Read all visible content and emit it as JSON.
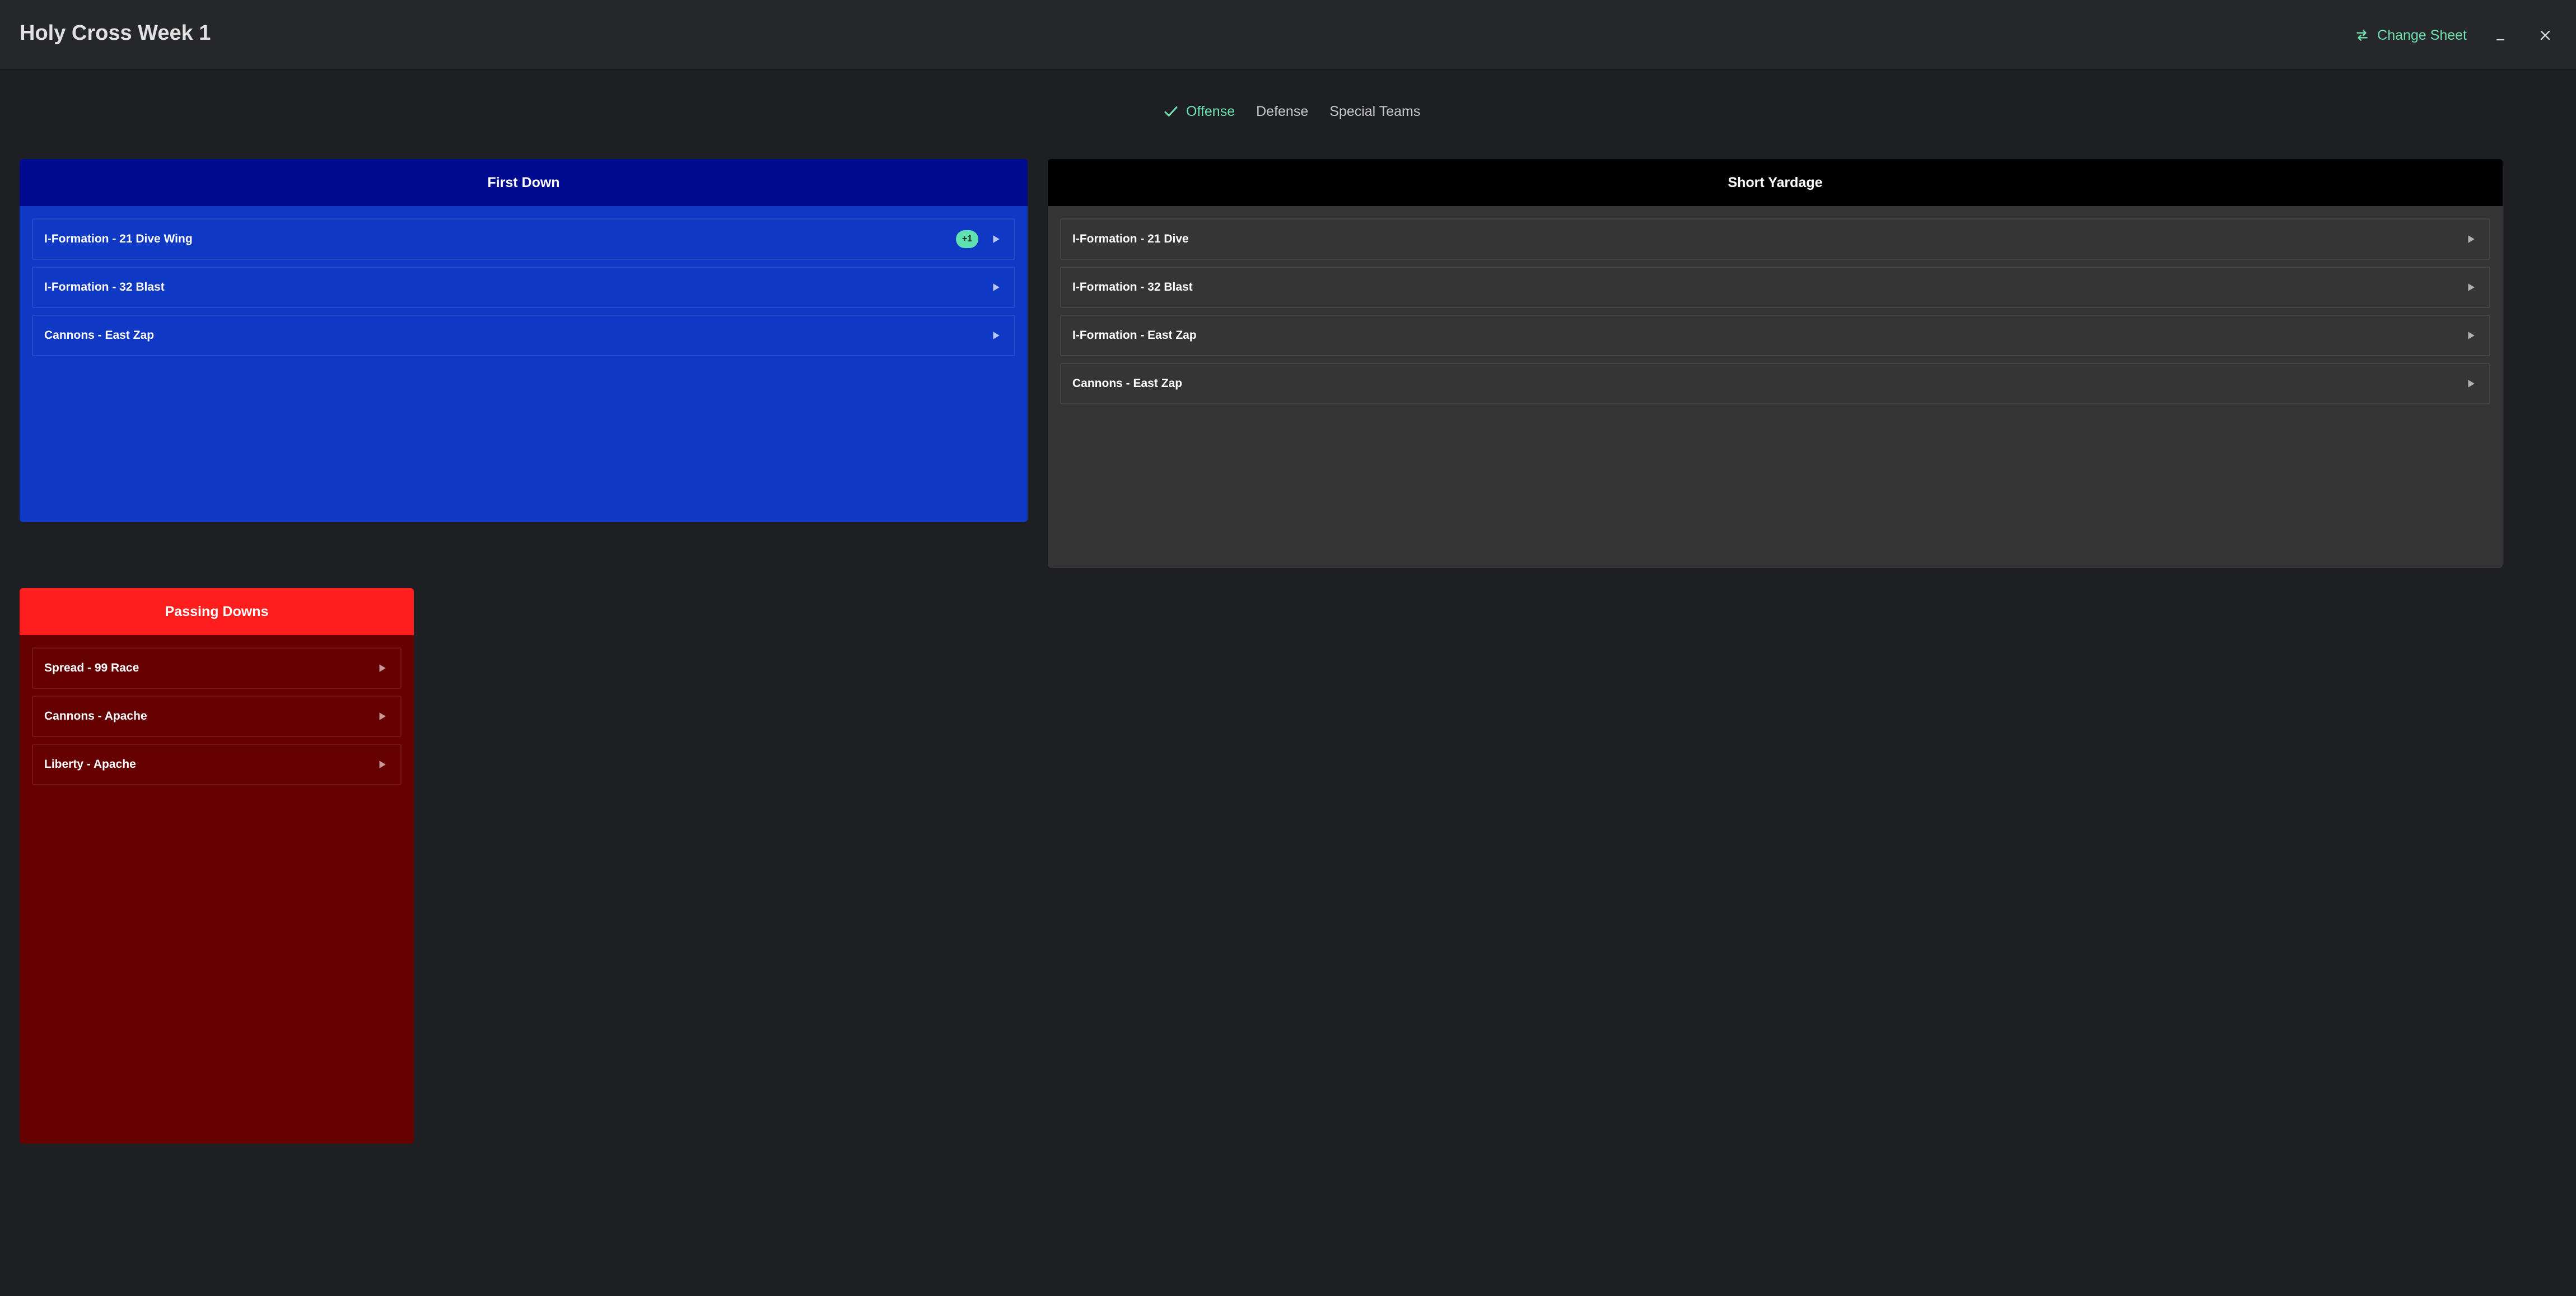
{
  "header": {
    "title": "Holy Cross Week 1",
    "change_sheet_label": "Change Sheet",
    "change_sheet_icon": "swap-arrows-icon",
    "accent_color": "#6fe3b1"
  },
  "tabs": [
    {
      "label": "Offense",
      "active": true,
      "icon": "check-icon"
    },
    {
      "label": "Defense",
      "active": false
    },
    {
      "label": "Special Teams",
      "active": false
    }
  ],
  "cards": {
    "first_down": {
      "title": "First Down",
      "header_color": "#000b8f",
      "body_color": "#0f39c4",
      "plays": [
        {
          "label": "I-Formation - 21 Dive Wing",
          "badge": "+1"
        },
        {
          "label": "I-Formation - 32 Blast"
        },
        {
          "label": "Cannons - East Zap"
        }
      ]
    },
    "short_yardage": {
      "title": "Short Yardage",
      "header_color": "#000000",
      "body_color": "#353535",
      "plays": [
        {
          "label": "I-Formation - 21 Dive"
        },
        {
          "label": "I-Formation - 32 Blast"
        },
        {
          "label": "I-Formation - East Zap"
        },
        {
          "label": "Cannons - East Zap"
        }
      ]
    },
    "passing_downs": {
      "title": "Passing Downs",
      "header_color": "#ff1e1e",
      "body_color": "#640000",
      "plays": [
        {
          "label": "Spread - 99 Race"
        },
        {
          "label": "Cannons - Apache"
        },
        {
          "label": "Liberty - Apache"
        }
      ]
    }
  }
}
